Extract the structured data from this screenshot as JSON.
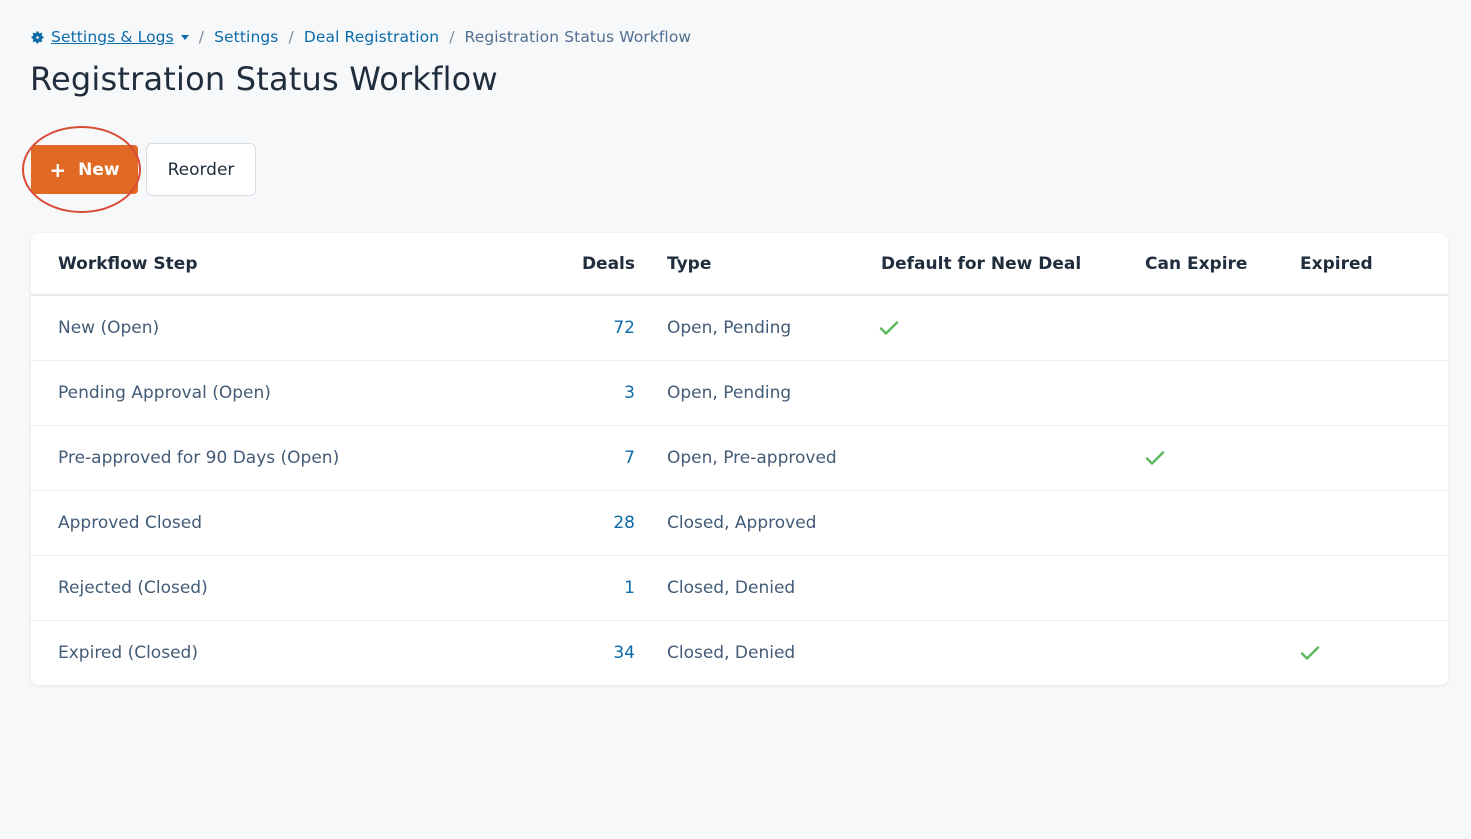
{
  "breadcrumb": {
    "root_label": "Settings & Logs",
    "settings_label": "Settings",
    "deal_registration_label": "Deal Registration",
    "current_label": "Registration Status Workflow",
    "separator": "/"
  },
  "page": {
    "title": "Registration Status Workflow"
  },
  "toolbar": {
    "new_icon": "+",
    "new_label": "New",
    "reorder_label": "Reorder"
  },
  "table": {
    "headers": {
      "step": "Workflow Step",
      "deals": "Deals",
      "type": "Type",
      "default": "Default for New Deal",
      "can_expire": "Can Expire",
      "expired": "Expired"
    },
    "rows": [
      {
        "step": "New (Open)",
        "deals": "72",
        "type": "Open, Pending",
        "default": true,
        "can_expire": false,
        "expired": false
      },
      {
        "step": "Pending Approval (Open)",
        "deals": "3",
        "type": "Open, Pending",
        "default": false,
        "can_expire": false,
        "expired": false
      },
      {
        "step": "Pre-approved for 90 Days (Open)",
        "deals": "7",
        "type": "Open, Pre-approved",
        "default": false,
        "can_expire": true,
        "expired": false
      },
      {
        "step": "Approved Closed",
        "deals": "28",
        "type": "Closed, Approved",
        "default": false,
        "can_expire": false,
        "expired": false
      },
      {
        "step": "Rejected (Closed)",
        "deals": "1",
        "type": "Closed, Denied",
        "default": false,
        "can_expire": false,
        "expired": false
      },
      {
        "step": "Expired (Closed)",
        "deals": "34",
        "type": "Closed, Denied",
        "default": false,
        "can_expire": false,
        "expired": true
      }
    ]
  },
  "colors": {
    "accent_orange": "#e06a23",
    "link_blue": "#0b6aa8",
    "check_green": "#5cb85c",
    "highlight_red": "#d94a37"
  },
  "icons": {
    "breadcrumb_root": "gear-icon",
    "breadcrumb_dropdown": "caret-down-icon",
    "new_button": "plus-icon",
    "boolean_true": "checkmark-icon"
  }
}
